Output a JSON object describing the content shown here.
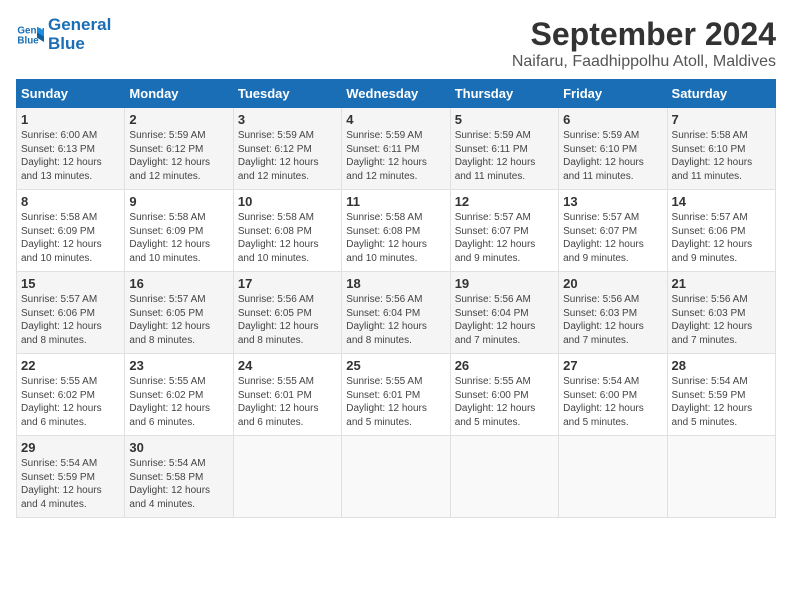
{
  "logo": {
    "line1": "General",
    "line2": "Blue"
  },
  "title": "September 2024",
  "location": "Naifaru, Faadhippolhu Atoll, Maldives",
  "weekdays": [
    "Sunday",
    "Monday",
    "Tuesday",
    "Wednesday",
    "Thursday",
    "Friday",
    "Saturday"
  ],
  "weeks": [
    [
      {
        "day": "1",
        "info": "Sunrise: 6:00 AM\nSunset: 6:13 PM\nDaylight: 12 hours\nand 13 minutes."
      },
      {
        "day": "2",
        "info": "Sunrise: 5:59 AM\nSunset: 6:12 PM\nDaylight: 12 hours\nand 12 minutes."
      },
      {
        "day": "3",
        "info": "Sunrise: 5:59 AM\nSunset: 6:12 PM\nDaylight: 12 hours\nand 12 minutes."
      },
      {
        "day": "4",
        "info": "Sunrise: 5:59 AM\nSunset: 6:11 PM\nDaylight: 12 hours\nand 12 minutes."
      },
      {
        "day": "5",
        "info": "Sunrise: 5:59 AM\nSunset: 6:11 PM\nDaylight: 12 hours\nand 11 minutes."
      },
      {
        "day": "6",
        "info": "Sunrise: 5:59 AM\nSunset: 6:10 PM\nDaylight: 12 hours\nand 11 minutes."
      },
      {
        "day": "7",
        "info": "Sunrise: 5:58 AM\nSunset: 6:10 PM\nDaylight: 12 hours\nand 11 minutes."
      }
    ],
    [
      {
        "day": "8",
        "info": "Sunrise: 5:58 AM\nSunset: 6:09 PM\nDaylight: 12 hours\nand 10 minutes."
      },
      {
        "day": "9",
        "info": "Sunrise: 5:58 AM\nSunset: 6:09 PM\nDaylight: 12 hours\nand 10 minutes."
      },
      {
        "day": "10",
        "info": "Sunrise: 5:58 AM\nSunset: 6:08 PM\nDaylight: 12 hours\nand 10 minutes."
      },
      {
        "day": "11",
        "info": "Sunrise: 5:58 AM\nSunset: 6:08 PM\nDaylight: 12 hours\nand 10 minutes."
      },
      {
        "day": "12",
        "info": "Sunrise: 5:57 AM\nSunset: 6:07 PM\nDaylight: 12 hours\nand 9 minutes."
      },
      {
        "day": "13",
        "info": "Sunrise: 5:57 AM\nSunset: 6:07 PM\nDaylight: 12 hours\nand 9 minutes."
      },
      {
        "day": "14",
        "info": "Sunrise: 5:57 AM\nSunset: 6:06 PM\nDaylight: 12 hours\nand 9 minutes."
      }
    ],
    [
      {
        "day": "15",
        "info": "Sunrise: 5:57 AM\nSunset: 6:06 PM\nDaylight: 12 hours\nand 8 minutes."
      },
      {
        "day": "16",
        "info": "Sunrise: 5:57 AM\nSunset: 6:05 PM\nDaylight: 12 hours\nand 8 minutes."
      },
      {
        "day": "17",
        "info": "Sunrise: 5:56 AM\nSunset: 6:05 PM\nDaylight: 12 hours\nand 8 minutes."
      },
      {
        "day": "18",
        "info": "Sunrise: 5:56 AM\nSunset: 6:04 PM\nDaylight: 12 hours\nand 8 minutes."
      },
      {
        "day": "19",
        "info": "Sunrise: 5:56 AM\nSunset: 6:04 PM\nDaylight: 12 hours\nand 7 minutes."
      },
      {
        "day": "20",
        "info": "Sunrise: 5:56 AM\nSunset: 6:03 PM\nDaylight: 12 hours\nand 7 minutes."
      },
      {
        "day": "21",
        "info": "Sunrise: 5:56 AM\nSunset: 6:03 PM\nDaylight: 12 hours\nand 7 minutes."
      }
    ],
    [
      {
        "day": "22",
        "info": "Sunrise: 5:55 AM\nSunset: 6:02 PM\nDaylight: 12 hours\nand 6 minutes."
      },
      {
        "day": "23",
        "info": "Sunrise: 5:55 AM\nSunset: 6:02 PM\nDaylight: 12 hours\nand 6 minutes."
      },
      {
        "day": "24",
        "info": "Sunrise: 5:55 AM\nSunset: 6:01 PM\nDaylight: 12 hours\nand 6 minutes."
      },
      {
        "day": "25",
        "info": "Sunrise: 5:55 AM\nSunset: 6:01 PM\nDaylight: 12 hours\nand 5 minutes."
      },
      {
        "day": "26",
        "info": "Sunrise: 5:55 AM\nSunset: 6:00 PM\nDaylight: 12 hours\nand 5 minutes."
      },
      {
        "day": "27",
        "info": "Sunrise: 5:54 AM\nSunset: 6:00 PM\nDaylight: 12 hours\nand 5 minutes."
      },
      {
        "day": "28",
        "info": "Sunrise: 5:54 AM\nSunset: 5:59 PM\nDaylight: 12 hours\nand 5 minutes."
      }
    ],
    [
      {
        "day": "29",
        "info": "Sunrise: 5:54 AM\nSunset: 5:59 PM\nDaylight: 12 hours\nand 4 minutes."
      },
      {
        "day": "30",
        "info": "Sunrise: 5:54 AM\nSunset: 5:58 PM\nDaylight: 12 hours\nand 4 minutes."
      },
      {
        "day": "",
        "info": ""
      },
      {
        "day": "",
        "info": ""
      },
      {
        "day": "",
        "info": ""
      },
      {
        "day": "",
        "info": ""
      },
      {
        "day": "",
        "info": ""
      }
    ]
  ]
}
